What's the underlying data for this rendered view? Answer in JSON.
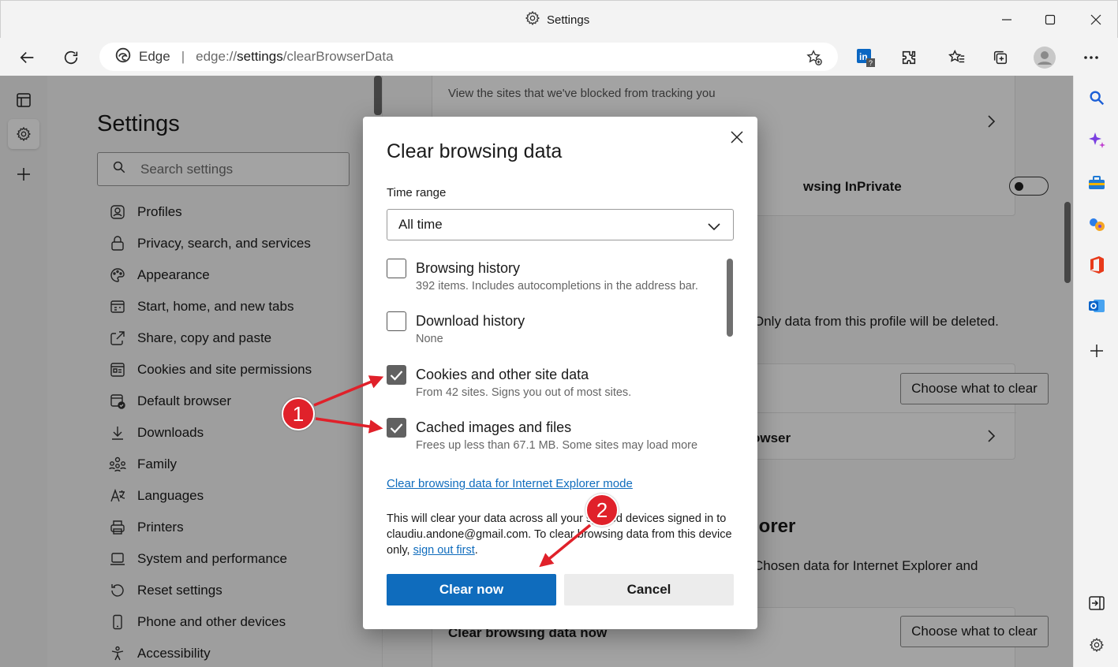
{
  "window": {
    "title": "Settings"
  },
  "address_bar": {
    "site_label": "Edge",
    "separator": "|",
    "url_prefix": "edge://",
    "url_host": "settings",
    "url_path": "/clearBrowserData"
  },
  "settings_nav": {
    "title": "Settings",
    "search_placeholder": "Search settings",
    "items": [
      {
        "label": "Profiles",
        "icon": "profile-icon"
      },
      {
        "label": "Privacy, search, and services",
        "icon": "lock-icon"
      },
      {
        "label": "Appearance",
        "icon": "palette-icon"
      },
      {
        "label": "Start, home, and new tabs",
        "icon": "start-icon"
      },
      {
        "label": "Share, copy and paste",
        "icon": "share-icon"
      },
      {
        "label": "Cookies and site permissions",
        "icon": "cookies-icon"
      },
      {
        "label": "Default browser",
        "icon": "default-browser-icon"
      },
      {
        "label": "Downloads",
        "icon": "download-icon"
      },
      {
        "label": "Family",
        "icon": "family-icon"
      },
      {
        "label": "Languages",
        "icon": "languages-icon"
      },
      {
        "label": "Printers",
        "icon": "printer-icon"
      },
      {
        "label": "System and performance",
        "icon": "system-icon"
      },
      {
        "label": "Reset settings",
        "icon": "reset-icon"
      },
      {
        "label": "Phone and other devices",
        "icon": "phone-icon"
      },
      {
        "label": "Accessibility",
        "icon": "accessibility-icon"
      }
    ]
  },
  "content": {
    "tracking_sub": "View the sites that we've blocked from tracking you",
    "inprivate_label": "wsing InPrivate",
    "profile_note": "Only data from this profile will be deleted.",
    "choose_label": "Choose what to clear",
    "on_close_label": "owser",
    "ie_heading": "lorer",
    "ie_sub": "Chosen data for Internet Explorer and",
    "clear_now_row": "Clear browsing data now"
  },
  "dialog": {
    "title": "Clear browsing data",
    "time_range_label": "Time range",
    "time_range_value": "All time",
    "options": [
      {
        "label": "Browsing history",
        "sub": "392 items. Includes autocompletions in the address bar.",
        "checked": false
      },
      {
        "label": "Download history",
        "sub": "None",
        "checked": false
      },
      {
        "label": "Cookies and other site data",
        "sub": "From 42 sites. Signs you out of most sites.",
        "checked": true
      },
      {
        "label": "Cached images and files",
        "sub": "Frees up less than 67.1 MB. Some sites may load more",
        "checked": true
      }
    ],
    "ie_link": "Clear browsing data for Internet Explorer mode",
    "info_text": "This will clear your data across all your synced devices signed in to claudiu.andone@gmail.com. To clear browsing data from this device only,",
    "info_link": "sign out first",
    "info_end": ".",
    "clear_button": "Clear now",
    "cancel_button": "Cancel"
  },
  "annotations": {
    "badge1": "1",
    "badge2": "2",
    "color": "#e0212a"
  },
  "colors": {
    "accent": "#0f6cbd",
    "checkbox_checked": "#616161"
  }
}
